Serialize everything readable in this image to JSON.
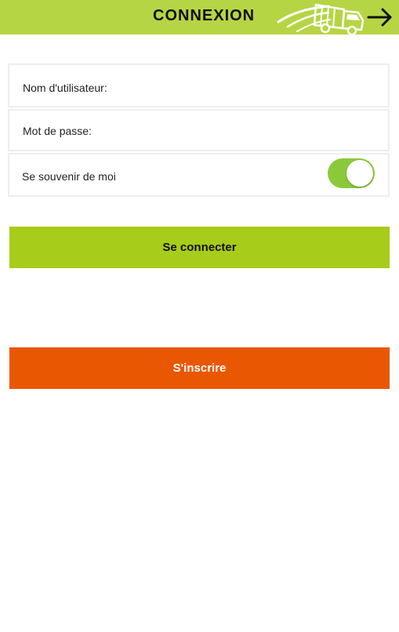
{
  "header": {
    "title": "CONNEXION",
    "logo_icon": "truck-logo-icon",
    "forward_icon": "arrow-right-icon",
    "bar_color": "#b6d544"
  },
  "form": {
    "username_label": "Nom d'utilisateur:",
    "username_value": "",
    "password_label": "Mot de passe:",
    "password_value": "",
    "remember_label": "Se souvenir de moi",
    "remember_on": true,
    "toggle_color": "#8bc93b"
  },
  "actions": {
    "login_label": "Se connecter",
    "login_color": "#a7cc19",
    "register_label": "S'inscrire",
    "register_color": "#ea5703"
  }
}
